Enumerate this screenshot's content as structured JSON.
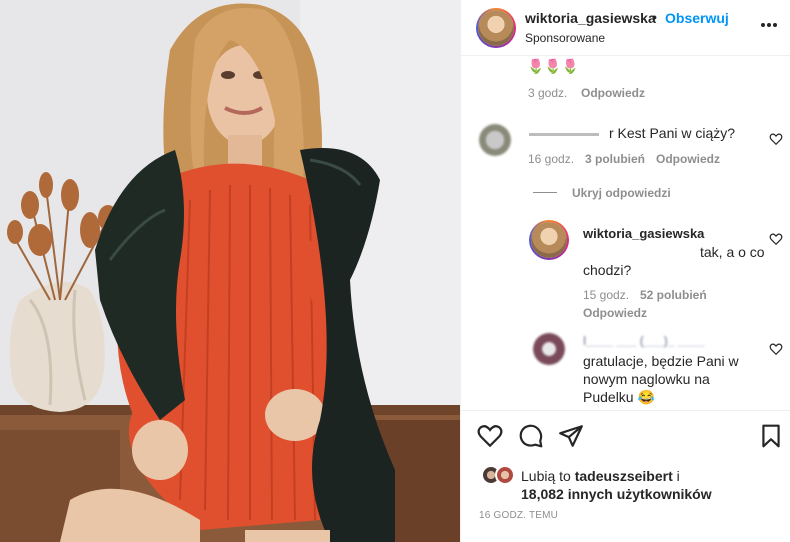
{
  "header": {
    "username": "wiktoria_gasiewska",
    "separator": "•",
    "follow_label": "Obserwuj",
    "sponsored_label": "Sponsorowane",
    "more_icon": "more-horizontal-icon"
  },
  "comments": {
    "top": {
      "emojis": "🌷🌷🌷",
      "time": "3 godz.",
      "reply_label": "Odpowiedz"
    },
    "first": {
      "text": "r Kest Pani w ciąży?",
      "time": "16 godz.",
      "likes": "3 polubień",
      "reply_label": "Odpowiedz"
    },
    "hide_replies_label": "Ukryj odpowiedzi",
    "reply": {
      "username": "wiktoria_gasiewska",
      "text_line1": "tak, a o co",
      "text_line2": "chodzi?",
      "time": "15 godz.",
      "likes": "52 polubień",
      "reply_label": "Odpowiedz"
    },
    "second": {
      "username_obscured": "l____ ___ (___)_ ____",
      "text_line1": "gratulacje, będzie Pani w",
      "text_line2": "nowym naglowku na",
      "text_line3": "Pudelku 😂"
    }
  },
  "actions": {
    "like_icon": "heart-icon",
    "comment_icon": "comment-icon",
    "share_icon": "send-icon",
    "save_icon": "bookmark-icon"
  },
  "likes": {
    "prefix": "Lubią to",
    "user": "tadeuszseibert",
    "suffix": "i",
    "count_line": "18,082 innych użytkowników"
  },
  "timestamp": "16 GODZ. TEMU"
}
